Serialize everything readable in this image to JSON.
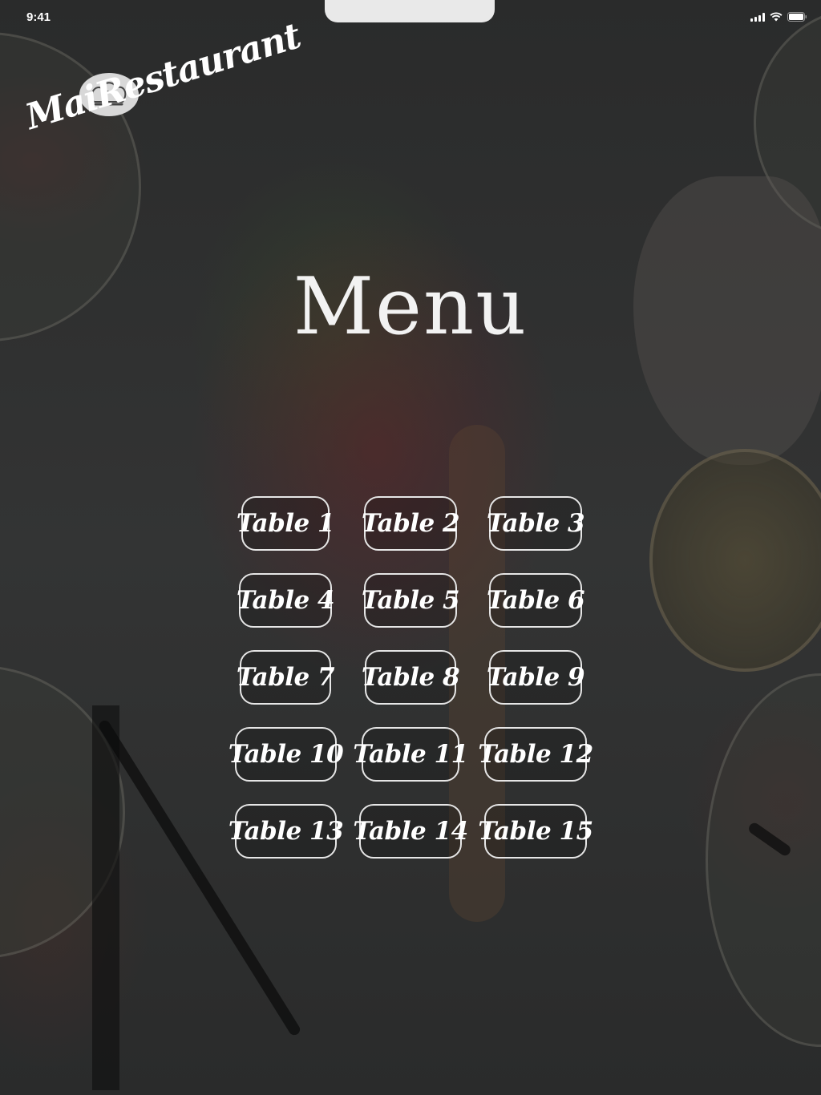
{
  "status_bar": {
    "time": "9:41"
  },
  "logo": {
    "brand_name": "MaiRestaurant",
    "icon": "chef-hat-icon"
  },
  "title": "Menu",
  "tables": [
    {
      "label": "Table 1"
    },
    {
      "label": "Table 2"
    },
    {
      "label": "Table 3"
    },
    {
      "label": "Table 4"
    },
    {
      "label": "Table 5"
    },
    {
      "label": "Table 6"
    },
    {
      "label": "Table 7"
    },
    {
      "label": "Table 8"
    },
    {
      "label": "Table 9"
    },
    {
      "label": "Table 10"
    },
    {
      "label": "Table 11"
    },
    {
      "label": "Table 12"
    },
    {
      "label": "Table 13"
    },
    {
      "label": "Table 14"
    },
    {
      "label": "Table 15"
    }
  ],
  "colors": {
    "accent": "#ffffff",
    "border": "#e6e6e6",
    "background": "#2b2c2c"
  }
}
